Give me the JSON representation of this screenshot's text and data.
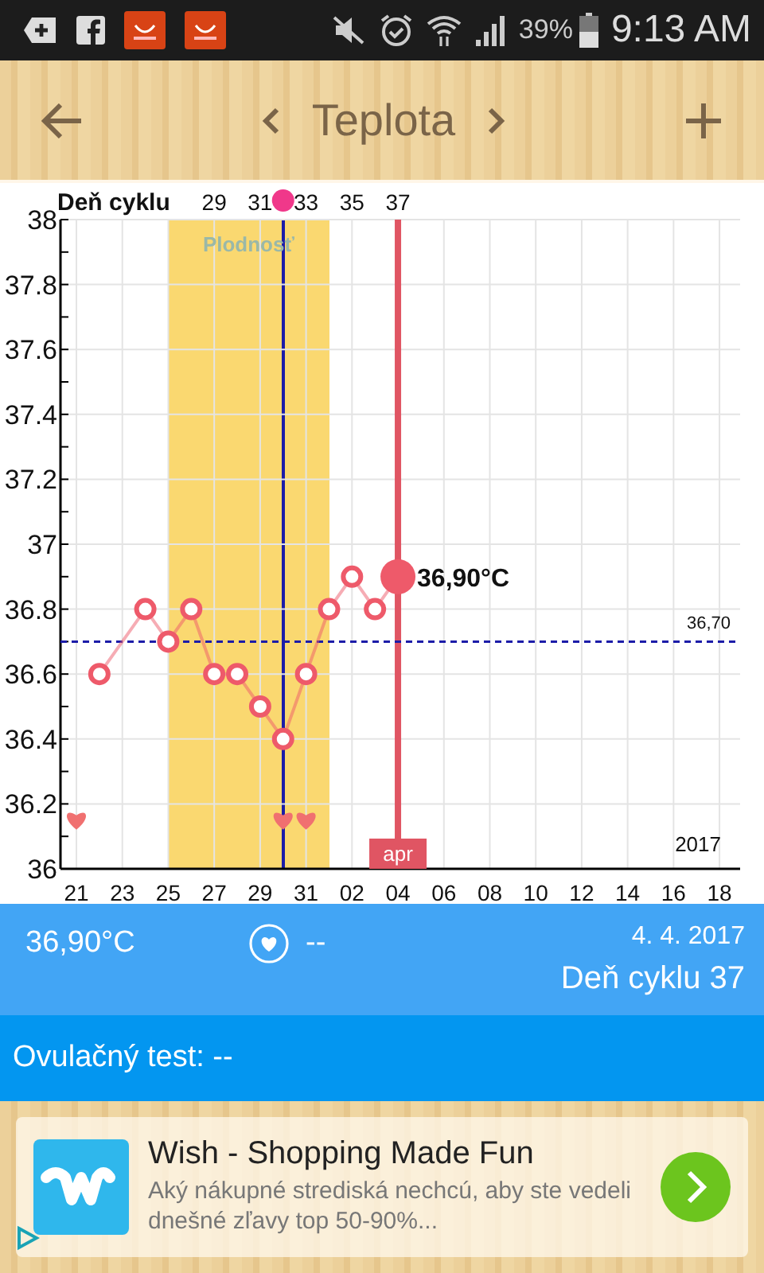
{
  "status_bar": {
    "battery": "39%",
    "time": "9:13 AM"
  },
  "header": {
    "title": "Teplota"
  },
  "chart": {
    "fertility_label": "Plodnosť",
    "cycle_axis": {
      "title": "Deň cyklu",
      "ticks": [
        "29",
        "31",
        "33",
        "35",
        "37"
      ]
    },
    "chart_data": {
      "type": "line",
      "grid": true,
      "categories": [
        "21",
        null,
        "23",
        null,
        "25",
        null,
        "27",
        null,
        "29",
        null,
        "31",
        null,
        "02",
        null,
        "04",
        null,
        "06",
        null,
        "08",
        null,
        "10",
        null,
        "12",
        null,
        "14",
        null,
        "16",
        null,
        "18"
      ],
      "ylim": [
        36,
        38
      ],
      "yticks": [
        36,
        36.2,
        36.4,
        36.6,
        36.8,
        37,
        37.2,
        37.4,
        37.6,
        37.8,
        38
      ],
      "series": [
        {
          "color": "#ee5a6a",
          "marker": "o",
          "values": [
            null,
            36.6,
            null,
            36.8,
            36.7,
            36.8,
            36.6,
            36.6,
            36.5,
            36.4,
            36.6,
            36.8,
            36.9,
            36.8,
            36.9,
            null,
            null,
            null,
            null,
            null,
            null,
            null,
            null,
            null,
            null,
            null,
            null,
            null,
            null
          ]
        }
      ],
      "ref_lines": [
        {
          "axis": "x",
          "value": "04",
          "color": "#e05563",
          "label": "apr"
        },
        {
          "axis": "y",
          "value": 36.7,
          "color": "#1c1ca8",
          "label": "36,70"
        }
      ],
      "annotations": [
        {
          "x": "04",
          "y": 36.9,
          "text": "36,90°C"
        },
        "2017"
      ]
    }
  },
  "summary": {
    "temperature": "36,90°C",
    "intercourse": "--",
    "date": "4. 4. 2017",
    "cycle_day": "Deň cyklu 37"
  },
  "ovulation_test": "Ovulačný test: --",
  "ad": {
    "title": "Wish - Shopping Made Fun",
    "text": "Aký nákupné strediská nechcú, aby ste vedeli  dnešné zľavy top 50-90%..."
  }
}
